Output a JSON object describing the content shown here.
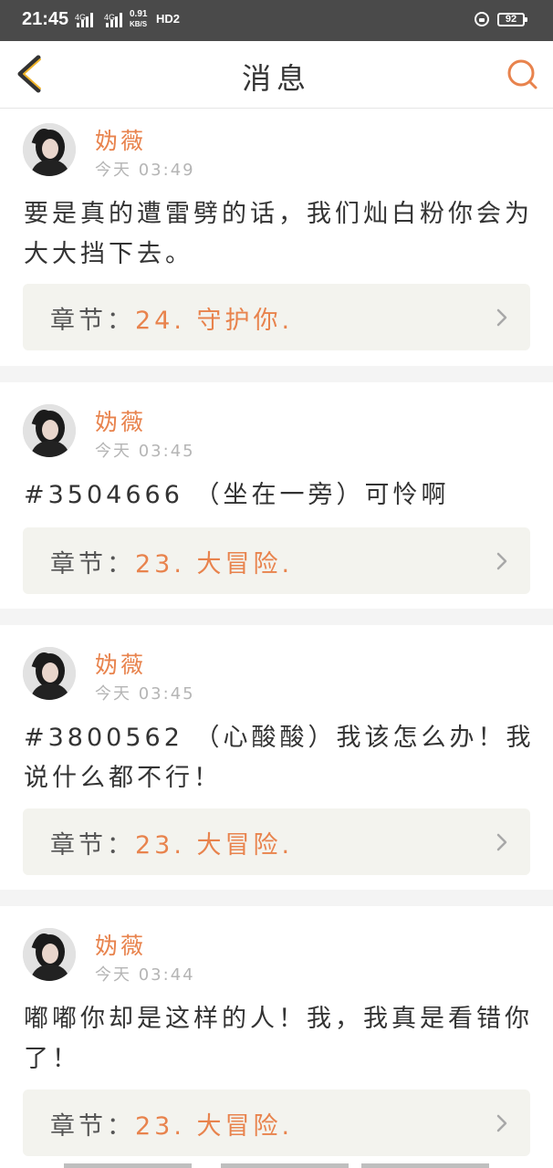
{
  "status_bar": {
    "time": "21:45",
    "net1": "4G",
    "net2": "4G",
    "speed_value": "0.91",
    "speed_unit": "KB/S",
    "hd": "HD2",
    "battery": "92"
  },
  "header": {
    "title": "消息",
    "back_icon": "chevron-left-icon",
    "search_icon": "search-icon"
  },
  "colors": {
    "accent": "#e8834d",
    "chapter_bg": "#f3f3ee",
    "text": "#333333",
    "muted": "#b5b5b5"
  },
  "messages": [
    {
      "name": "妫薇",
      "time": "今天 03:49",
      "content": "要是真的遭雷劈的话，我们灿白粉你会为大大挡下去。",
      "chapter_prefix": "章节：",
      "chapter_name": "24. 守护你."
    },
    {
      "name": "妫薇",
      "time": "今天 03:45",
      "content": "#3504666 （坐在一旁）可怜啊",
      "chapter_prefix": "章节：",
      "chapter_name": "23. 大冒险."
    },
    {
      "name": "妫薇",
      "time": "今天 03:45",
      "content": "#3800562 （心酸酸）我该怎么办！我说什么都不行！",
      "chapter_prefix": "章节：",
      "chapter_name": "23. 大冒险."
    },
    {
      "name": "妫薇",
      "time": "今天 03:44",
      "content": "嘟嘟你却是这样的人！我，我真是看错你了！",
      "chapter_prefix": "章节：",
      "chapter_name": "23. 大冒险."
    }
  ]
}
